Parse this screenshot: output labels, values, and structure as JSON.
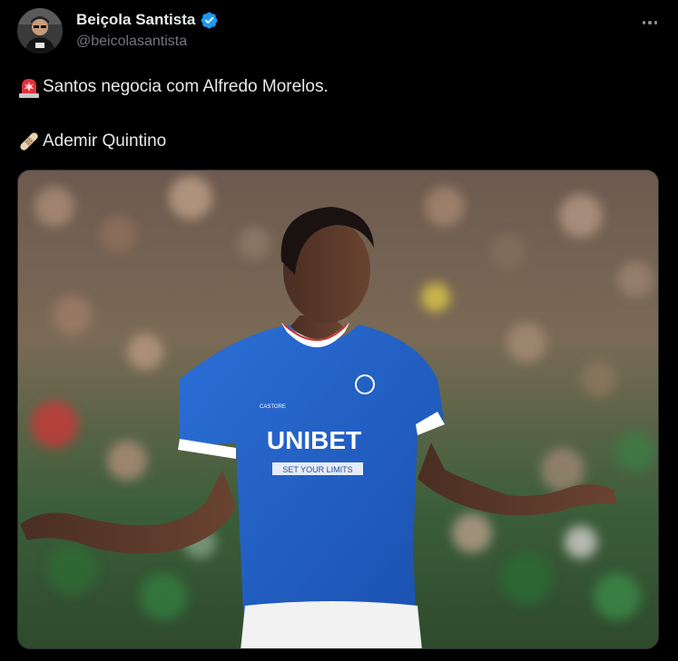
{
  "author": {
    "display_name": "Beiçola Santista",
    "handle": "@beicolasantista",
    "verified": true,
    "avatar_icon": "avatar-photo"
  },
  "tweet": {
    "line1_emoji": "rotating-light-icon",
    "line1_text": "Santos negocia com Alfredo Morelos.",
    "line2_emoji": "adhesive-bandage-icon",
    "line2_text": "Ademir Quintino"
  },
  "media": {
    "description_icon": "player-photo",
    "shirt_sponsor": "UNIBET",
    "shirt_tagline": "SET YOUR LIMITS",
    "shirt_kit_brand": "CASTORE"
  },
  "colors": {
    "background": "#000000",
    "text": "#e7e9ea",
    "muted": "#71767b",
    "verified": "#1d9bf0",
    "jersey": "#1f5fc4"
  }
}
